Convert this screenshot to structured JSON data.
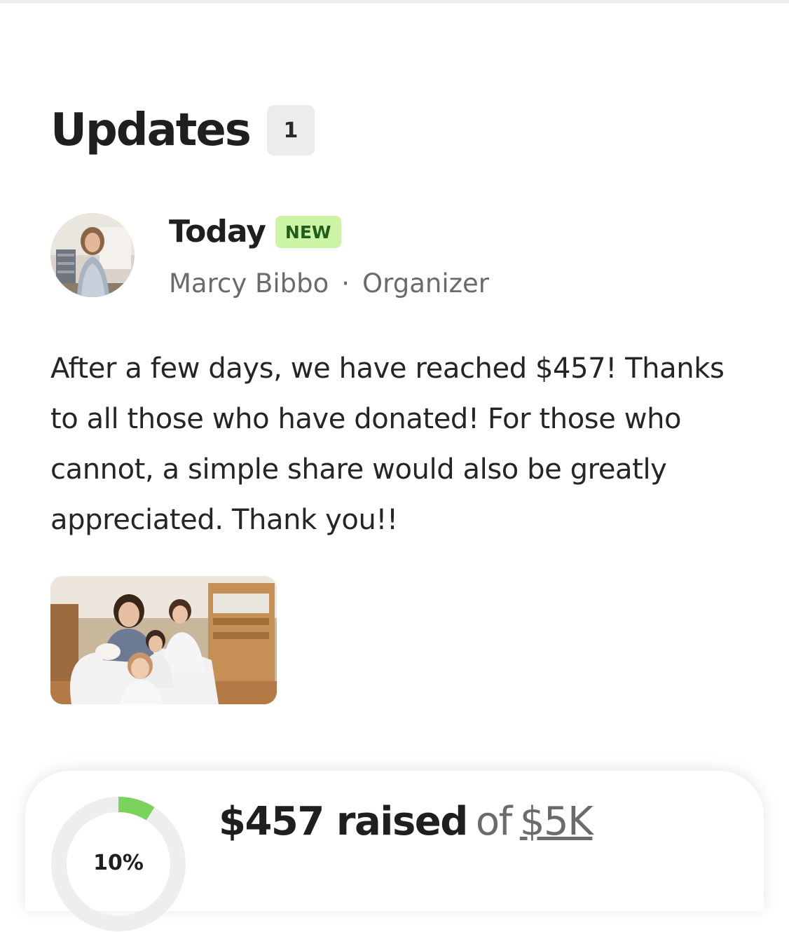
{
  "updates": {
    "title": "Updates",
    "count": "1"
  },
  "update": {
    "date": "Today",
    "badge": "NEW",
    "author": "Marcy Bibbo",
    "separator": "·",
    "role": "Organizer",
    "body": "After a few days, we have reached $457! Thanks to all those who have donated! For those who cannot, a simple share would also be greatly appreciated. Thank you!!"
  },
  "progress": {
    "raised": "$457 raised",
    "of": "of",
    "goal": "$5K",
    "percent_label": "10%",
    "fraction": 0.09
  },
  "colors": {
    "accent_green": "#7bd35c",
    "new_badge_bg": "#cdf3a4",
    "new_badge_text": "#1f5e1c"
  }
}
